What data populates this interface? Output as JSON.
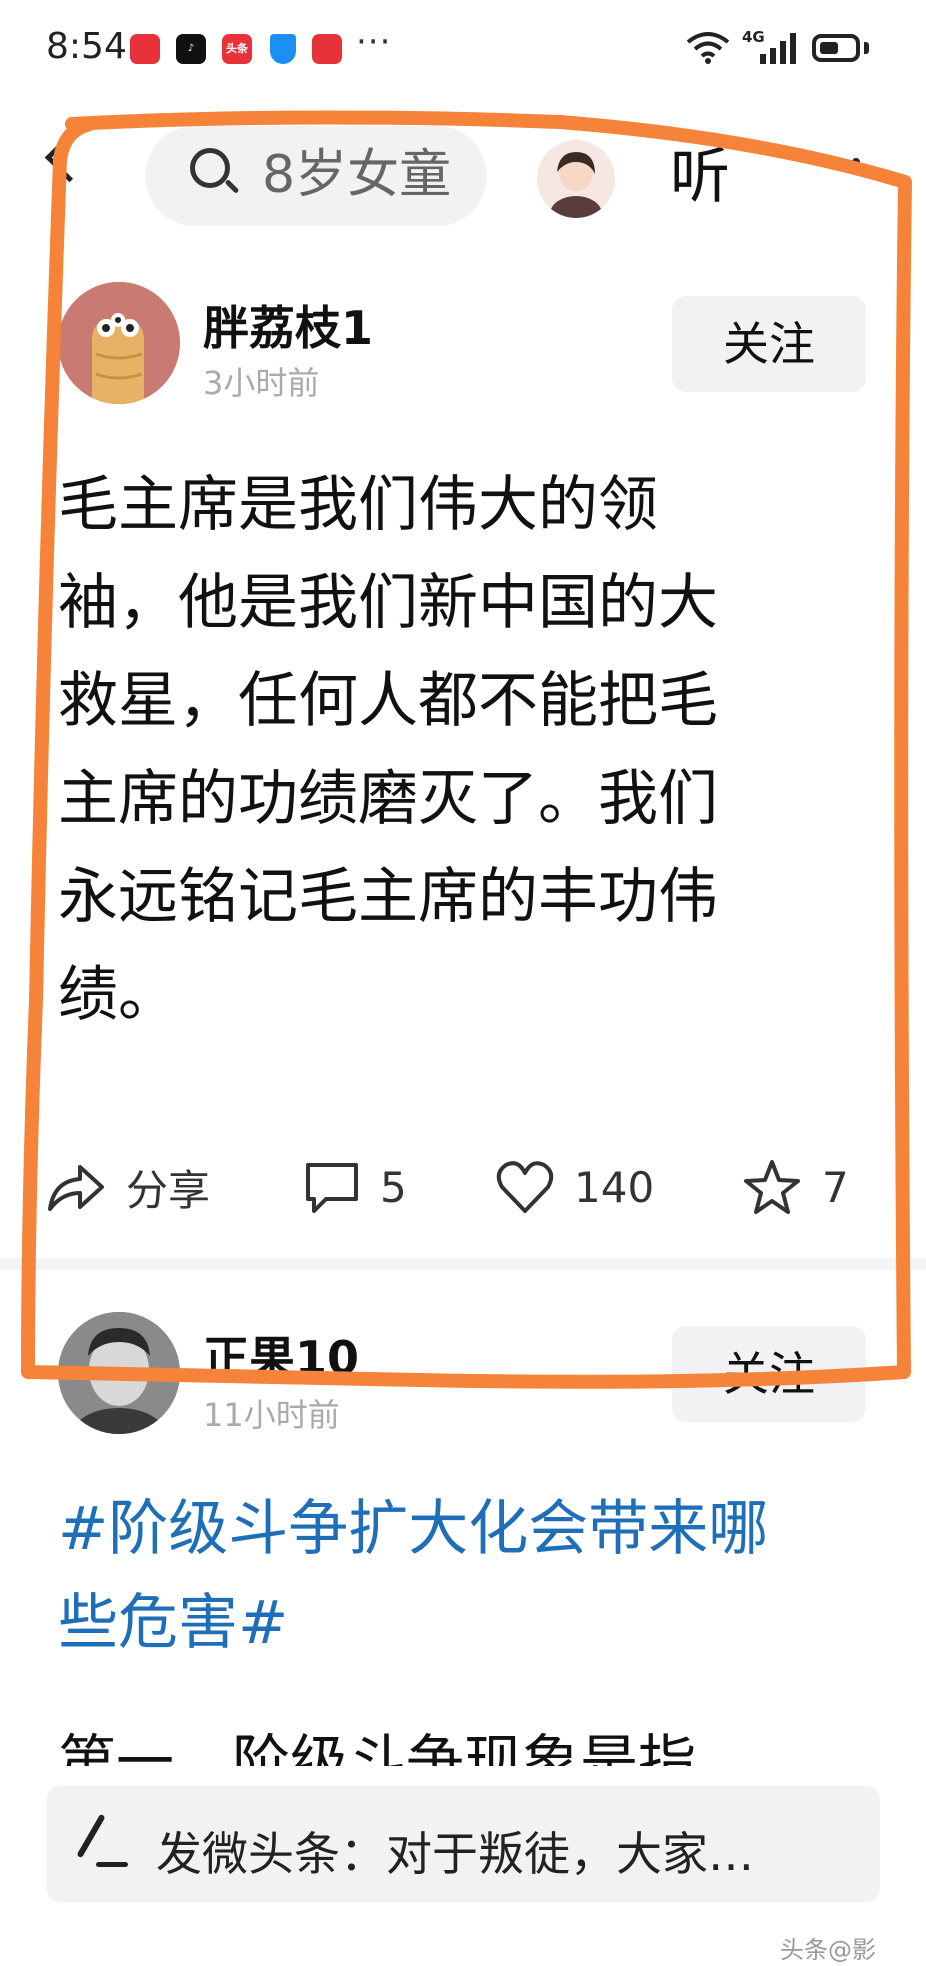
{
  "status_bar": {
    "time": "8:54",
    "app_icons": [
      {
        "name": "huawei-shop-icon",
        "label": "HUAWEI",
        "color": "#e8323a"
      },
      {
        "name": "tiktok-icon",
        "label": "♪",
        "color": "#111111"
      },
      {
        "name": "toutiao-icon",
        "label": "头条",
        "color": "#e8323a"
      },
      {
        "name": "shield-app-icon",
        "label": "",
        "color": "#1b8ff2"
      },
      {
        "name": "huawei-shop-icon-2",
        "label": "HUAWEI",
        "color": "#e8323a"
      }
    ],
    "more": "···",
    "network": "4G"
  },
  "top_bar": {
    "search_text": "8岁女童",
    "listen_label": "听"
  },
  "post1": {
    "author": "胖荔枝1",
    "time": "3小时前",
    "follow_label": "关注",
    "content_lines": [
      "毛主席是我们伟大的领",
      "袖，他是我们新中国的大",
      "救星，任何人都不能把毛",
      "主席的功绩磨灭了。我们",
      "永远铭记毛主席的丰功伟",
      "绩。"
    ],
    "actions": {
      "share": "分享",
      "comments": "5",
      "likes": "140",
      "favorites": "7"
    }
  },
  "post2": {
    "author": "正果10",
    "time": "11小时前",
    "follow_label": "关注",
    "topic_lines": [
      "#阶级斗争扩大化会带来哪",
      "些危害#"
    ],
    "body_start": "第一，阶级斗争现象是指"
  },
  "composer": {
    "text": "发微头条：对于叛徒，大家…"
  },
  "watermark": "头条@影",
  "colors": {
    "annotation": "#f5843a",
    "topic": "#1e6fb7"
  }
}
